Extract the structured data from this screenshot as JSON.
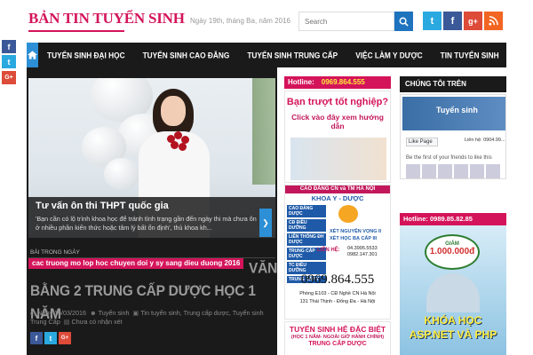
{
  "header": {
    "logo": "BẢN TIN TUYỂN SINH",
    "date": "Ngày 19th, tháng Ba, năm 2016",
    "search_placeholder": "Search",
    "social": [
      "twitter-icon",
      "facebook-icon",
      "google-plus-icon",
      "rss-icon"
    ]
  },
  "nav": {
    "items": [
      "TUYỂN SINH ĐẠI HỌC",
      "TUYỂN SINH CAO ĐẲNG",
      "TUYỂN SINH TRUNG CẤP",
      "VIỆC LÀM Y DƯỢC",
      "TIN TUYỂN SINH"
    ]
  },
  "share_left": [
    "f",
    "t",
    "G+"
  ],
  "slider": {
    "title": "Tư vấn ôn thi THPT quốc gia",
    "excerpt": "'Bạn cần có lộ trình khoa học để tránh tình trạng gần đến ngày thi mà chưa ôn ở nhiều phần kiến thức hoặc tâm lý bất ổn định', thủ khoa kh..."
  },
  "article": {
    "section": "BÀI TRONG NGÀY",
    "ticker": "cac truong mo lop hoc chuyen doi y sy sang dieu duong 2016",
    "headline": "VĂN BẰNG 2 TRUNG CẤP DƯỢC HỌC 1 NĂM",
    "date": "Ngày 16/03/2016",
    "author": "Tuyển sinh",
    "tags": "Tin tuyển sinh, Trung cấp dược, Tuyển sinh Trung Cấp",
    "comments": "Chưa có nhận xét"
  },
  "ads": {
    "hotline_label": "Hotline:",
    "hotline_number": "0969.864.555",
    "ad1_line1": "Bạn trượt tốt nghiệp?",
    "ad1_line2": "Click vào đây xem hướng dẫn",
    "ad2_header": "CAO ĐẲNG CN và TM HÀ NỘI",
    "ad2_sub": "KHOA Y - DƯỢC",
    "ad2_items": [
      "CAO ĐẲNG DƯỢC",
      "CĐ ĐIỀU DƯỠNG",
      "LIÊN THÔNG ĐH DƯỢC",
      "TRUNG CẤP DƯỢC",
      "TC ĐIỀU DƯỠNG",
      "TRUNG CẤP Y"
    ],
    "ad2_xet1": "XÉT NGUYỆN VỌNG II",
    "ad2_xet2": "XÉT HỌC BẠ CẤP III",
    "ad2_contact_label": "LIÊN HỆ:",
    "ad2_phone1": "04.3995.5533",
    "ad2_phone2": "0982.147.301",
    "ad2_phone_big": "0969.864.555",
    "ad2_addr1": "Phòng E103 - CĐ Nghề CN Hà Nội",
    "ad2_addr2": "131 Thái Thịnh - Đống Đa - Hà Nội",
    "ad3_title": "TUYỂN SINH HỆ ĐẶC BIỆT",
    "ad3_sub": "(HỌC 1 NĂM- NGOÀI GIỜ HÀNH CHÍNH)",
    "ad3_more": "TRUNG CẤP DƯỢC"
  },
  "sidebar": {
    "fb_title": "CHÚNG TÔI TRÊN FACEBOOK",
    "fb_page": "Tuyển sinh",
    "fb_like": "Like Page",
    "fb_count": "Liên hệ: 0904.99...",
    "fb_friends": "Be the first of your friends to like this",
    "hot2": "Hotline: 0989.85.82.85",
    "asp_giam": "GIẢM",
    "asp_amount": "1.000.000đ",
    "asp_line1": "KHÓA HỌC",
    "asp_line2": "ASP.NET VÀ PHP"
  },
  "colors": {
    "brand": "#d4145a",
    "nav_bg": "#1a1a1a",
    "accent": "#2d8fd5"
  }
}
